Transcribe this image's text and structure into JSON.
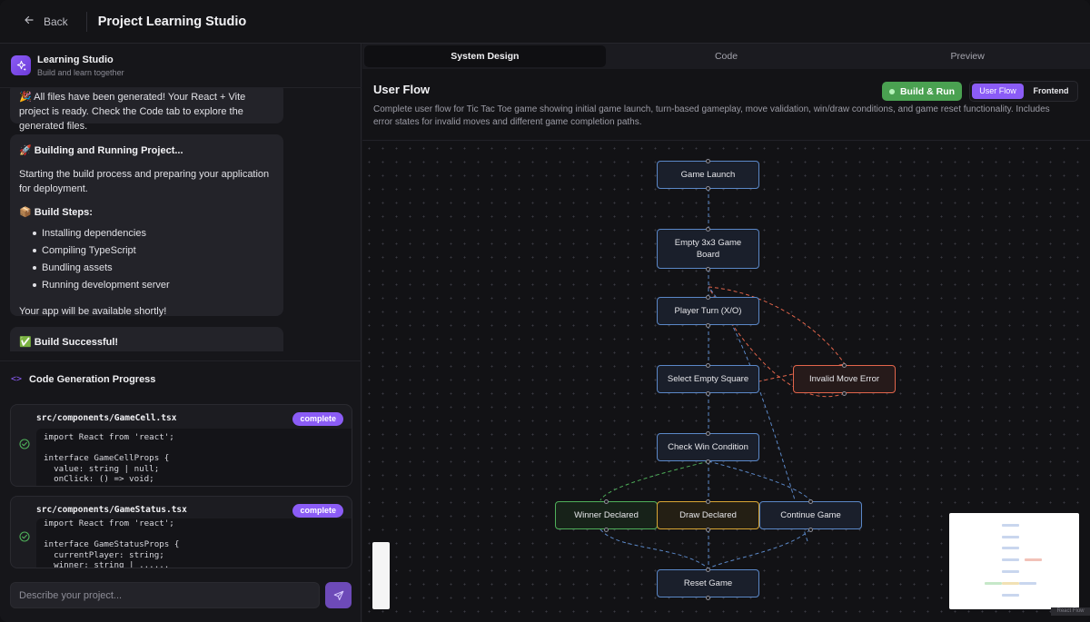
{
  "header": {
    "back_label": "Back",
    "title": "Project Learning Studio"
  },
  "sidebar": {
    "brand_name": "Learning Studio",
    "brand_subtitle": "Build and learn together",
    "messages": {
      "m1_text": "🎉 All files have been generated! Your React + Vite project is ready. Check the Code tab to explore the generated files.",
      "m2_title": "🚀 Building and Running Project...",
      "m2_text": "Starting the build process and preparing your application for deployment.",
      "m2_steps_title": "📦 Build Steps:",
      "m2_steps": [
        "Installing dependencies",
        "Compiling TypeScript",
        "Bundling assets",
        "Running development server"
      ],
      "m2_footer": "Your app will be available shortly!",
      "m3_title": "✅ Build Successful!"
    },
    "progress_icon": "<>",
    "progress_title": "Code Generation Progress",
    "files": [
      {
        "name": "src/components/GameCell.tsx",
        "status": "complete",
        "code": "import React from 'react';\n\ninterface GameCellProps {\n  value: string | null;\n  onClick: () => void;"
      },
      {
        "name": "src/components/GameStatus.tsx",
        "status": "complete",
        "code": "import React from 'react';\n\ninterface GameStatusProps {\n  currentPlayer: string;\n  winner: string | ......"
      }
    ],
    "input_placeholder": "Describe your project..."
  },
  "tabs": [
    "System Design",
    "Code",
    "Preview"
  ],
  "active_tab": "System Design",
  "flow": {
    "title": "User Flow",
    "description": "Complete user flow for Tic Tac Toe game showing initial game launch, turn-based gameplay, move validation, win/draw conditions, and game reset functionality. Includes error states for invalid moves and different game completion paths.",
    "build_button": "Build & Run",
    "view_options": [
      "User Flow",
      "Frontend"
    ],
    "selected_view": "User Flow",
    "nodes": {
      "launch": "Game Launch",
      "board": "Empty 3x3 Game Board",
      "turn": "Player Turn (X/O)",
      "select": "Select Empty Square",
      "invalid": "Invalid Move Error",
      "check": "Check Win Condition",
      "winner": "Winner Declared",
      "draw": "Draw Declared",
      "continue": "Continue Game",
      "reset": "Reset Game"
    },
    "attribution": "React Flow"
  },
  "colors": {
    "accent": "#8b5cf6",
    "success": "#4aa151",
    "node_blue": "#5b88c8",
    "node_red": "#e2654b",
    "node_green": "#4fb05a",
    "node_yellow": "#d9a634"
  }
}
